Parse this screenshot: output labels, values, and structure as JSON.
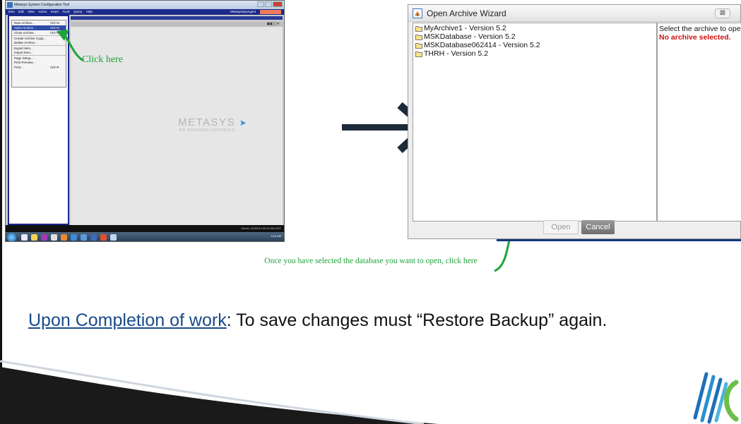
{
  "left_screenshot": {
    "window_title": "Metasys System Configuration Tool",
    "menu": [
      "Item",
      "Edit",
      "View",
      "Action",
      "Insert",
      "Tools",
      "Query",
      "Help"
    ],
    "menubar_right": "MetasysSysAgent",
    "file_menu_items": [
      {
        "label": "New Archive...",
        "shortcut": "Ctrl+N"
      },
      {
        "label": "Open Archive...",
        "shortcut": "Ctrl+O"
      },
      {
        "label": "Close Archive...",
        "shortcut": "Ctrl+F4"
      },
      {
        "label": "Create Archive Copy...",
        "shortcut": ""
      },
      {
        "label": "Delete Archive...",
        "shortcut": ""
      },
      {
        "label": "Export Item...",
        "shortcut": ""
      },
      {
        "label": "Import Item...",
        "shortcut": ""
      },
      {
        "label": "Page Setup...",
        "shortcut": ""
      },
      {
        "label": "Print Preview...",
        "shortcut": ""
      },
      {
        "label": "Print...",
        "shortcut": "Ctrl+P"
      }
    ],
    "logo_text": "METASYS",
    "logo_subtext": "BY JOHNSON CONTROLS",
    "status_text": "Server: 8/4/2014 09:23 AM EDT",
    "tray_time": "9:23 AM"
  },
  "annotations": {
    "click_here": "Click here",
    "open_note": "Once you have selected the database you want to open, click here"
  },
  "wizard": {
    "title": "Open Archive Wizard",
    "archives": [
      "MyArchive1  - Version 5.2",
      "MSKDatabase  - Version 5.2",
      "MSKDatabase062414  - Version 5.2",
      "THRH  - Version 5.2"
    ],
    "hint": "Select the archive to open.",
    "warning": "No archive selected.",
    "open_label": "Open",
    "cancel_label": "Cancel"
  },
  "footer": {
    "underlined": "Upon Completion of work",
    "rest": ": To save changes must “Restore  Backup” again."
  },
  "colors": {
    "annotation_green": "#1fa33a",
    "warning_red": "#cc1111",
    "menubar_blue": "#1b2a8a",
    "arrow": "#1e2a3a"
  }
}
